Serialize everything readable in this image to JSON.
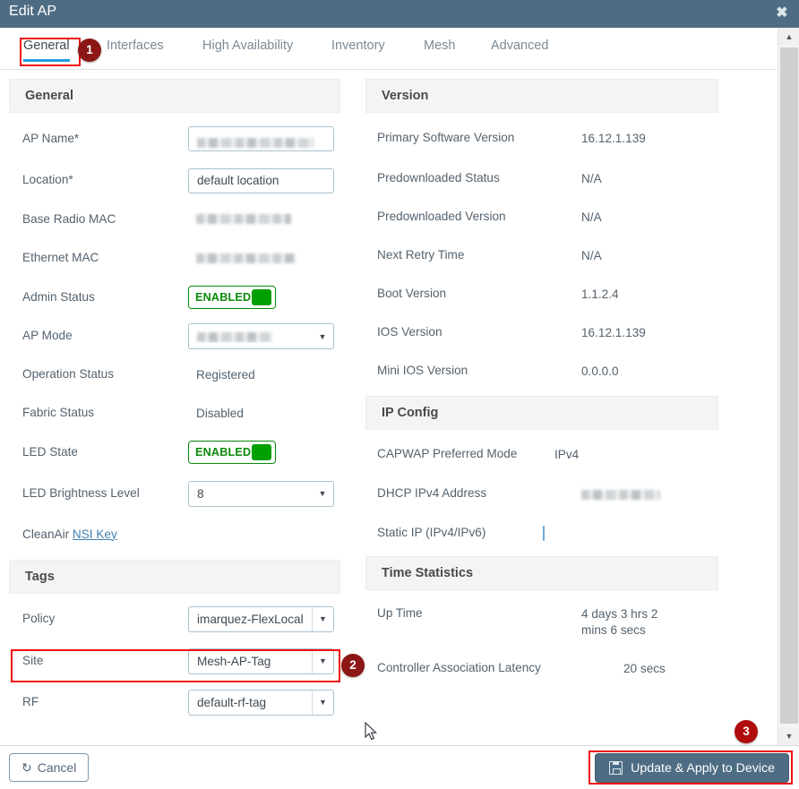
{
  "window": {
    "title": "Edit AP",
    "close_icon": "close-icon"
  },
  "tabs": [
    {
      "label": "General",
      "active": true
    },
    {
      "label": "Interfaces",
      "active": false
    },
    {
      "label": "High Availability",
      "active": false
    },
    {
      "label": "Inventory",
      "active": false
    },
    {
      "label": "Mesh",
      "active": false
    },
    {
      "label": "Advanced",
      "active": false
    }
  ],
  "annotations": {
    "step1": "1",
    "step2": "2",
    "step3": "3"
  },
  "general": {
    "header": "General",
    "ap_name": {
      "label": "AP Name*",
      "value": "",
      "redacted": true
    },
    "location": {
      "label": "Location*",
      "value": "default location"
    },
    "base_radio_mac": {
      "label": "Base Radio MAC",
      "value": "",
      "redacted": true
    },
    "ethernet_mac": {
      "label": "Ethernet MAC",
      "value": "",
      "redacted": true
    },
    "admin_status": {
      "label": "Admin Status",
      "value": "ENABLED"
    },
    "ap_mode": {
      "label": "AP Mode",
      "value": "",
      "redacted": true
    },
    "operation_status": {
      "label": "Operation Status",
      "value": "Registered"
    },
    "fabric_status": {
      "label": "Fabric Status",
      "value": "Disabled"
    },
    "led_state": {
      "label": "LED State",
      "value": "ENABLED"
    },
    "led_brightness": {
      "label": "LED Brightness Level",
      "value": "8"
    },
    "cleanair": {
      "label": "CleanAir",
      "link_label": "NSI Key"
    }
  },
  "tags": {
    "header": "Tags",
    "policy": {
      "label": "Policy",
      "value": "imarquez-FlexLocal"
    },
    "site": {
      "label": "Site",
      "value": "Mesh-AP-Tag"
    },
    "rf": {
      "label": "RF",
      "value": "default-rf-tag"
    }
  },
  "version": {
    "header": "Version",
    "rows": [
      {
        "label": "Primary Software Version",
        "value": "16.12.1.139"
      },
      {
        "label": "Predownloaded Status",
        "value": "N/A"
      },
      {
        "label": "Predownloaded Version",
        "value": "N/A"
      },
      {
        "label": "Next Retry Time",
        "value": "N/A"
      },
      {
        "label": "Boot Version",
        "value": "1.1.2.4"
      },
      {
        "label": "IOS Version",
        "value": "16.12.1.139"
      },
      {
        "label": "Mini IOS Version",
        "value": "0.0.0.0"
      }
    ]
  },
  "ip_config": {
    "header": "IP Config",
    "capwap_mode": {
      "label": "CAPWAP Preferred Mode",
      "value": "IPv4"
    },
    "dhcp_ipv4": {
      "label": "DHCP IPv4 Address",
      "value": "",
      "redacted": true
    },
    "static_ip": {
      "label": "Static IP (IPv4/IPv6)",
      "checked": false
    }
  },
  "time_statistics": {
    "header": "Time Statistics",
    "up_time": {
      "label": "Up Time",
      "value": "4 days 3 hrs 2 mins 6 secs"
    },
    "latency": {
      "label": "Controller Association Latency",
      "value": "20 secs"
    }
  },
  "footer": {
    "cancel_label": "Cancel",
    "cancel_icon": "undo-arrow-icon",
    "apply_label": "Update & Apply to Device",
    "apply_icon": "save-disk-icon"
  },
  "colors": {
    "titlebar": "#4e6d84",
    "accent_tab": "#1f9bde",
    "enabled_green": "#00a000",
    "highlight_red": "#ee1111",
    "badge_dark": "#8d1616",
    "badge_bright": "#b00c0c",
    "primary_button": "#4e6d84"
  }
}
